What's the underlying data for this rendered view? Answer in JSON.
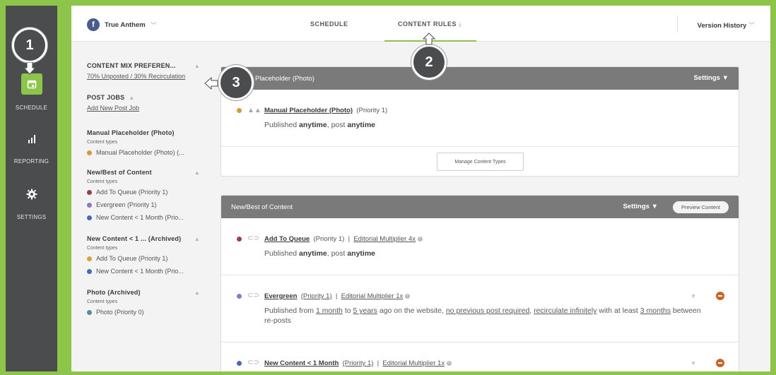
{
  "rail": {
    "items": [
      {
        "label": "SCHEDULE",
        "icon": "calendar-icon"
      },
      {
        "label": "REPORTING",
        "icon": "bar-chart-icon"
      },
      {
        "label": "SETTINGS",
        "icon": "gear-icon"
      }
    ]
  },
  "topbar": {
    "account_name": "True Anthem",
    "account_icon_letter": "f",
    "tabs": [
      {
        "label": "SCHEDULE"
      },
      {
        "label": "CONTENT RULES"
      }
    ],
    "version_history": "Version History"
  },
  "sidebar": {
    "content_mix": {
      "heading": "CONTENT MIX PREFEREN...",
      "value": "70% Unposted / 30% Recirculation"
    },
    "post_jobs": {
      "heading": "POST JOBS",
      "link": "Add New Post Job"
    },
    "jobs": [
      {
        "heading": "Manual Placeholder (Photo)",
        "sub": "Content types",
        "types": [
          {
            "label": "Manual Placeholder (Photo) (...",
            "color": "#d49a3a"
          }
        ]
      },
      {
        "heading": "New/Best of Content",
        "sub": "Content types",
        "types": [
          {
            "label": "Add To Queue (Priority 1)",
            "color": "#9a3f4c"
          },
          {
            "label": "Evergreen (Priority 1)",
            "color": "#8a7ac0"
          },
          {
            "label": "New Content < 1 Month (Prio...",
            "color": "#4b68b8"
          }
        ]
      },
      {
        "heading": "New Content < 1 ... (Archived)",
        "sub": "Content types",
        "types": [
          {
            "label": "Add To Queue (Priority 1)",
            "color": "#d4a43a"
          },
          {
            "label": "New Content < 1 Month (Prio...",
            "color": "#4b68b8"
          }
        ]
      },
      {
        "heading": "Photo (Archived)",
        "sub": "Content types",
        "types": [
          {
            "label": "Photo (Priority 0)",
            "color": "#5a8aa0"
          }
        ]
      }
    ]
  },
  "card1": {
    "title": "Placeholder (Photo)",
    "settings": "Settings",
    "row": {
      "name": "Manual Placeholder (Photo)",
      "priority": "(Priority 1)",
      "desc_a": "Published ",
      "desc_b": "anytime",
      "desc_c": ", post ",
      "desc_d": "anytime",
      "dot_color": "#d49a3a"
    },
    "manage": "Manage Content Types"
  },
  "card2": {
    "title": "New/Best of Content",
    "settings": "Settings",
    "preview": "Preview Content",
    "rows": [
      {
        "name": "Add To Queue",
        "priority": "(Priority 1)",
        "sep": "|",
        "multiplier": "Editorial Multiplier 4x",
        "dot_color": "#9a3f4c"
      },
      {
        "name": "Evergreen",
        "priority": "(Priority 1)",
        "sep": "|",
        "multiplier": "Editorial Multiplier 1x",
        "dot_color": "#8a7ac0"
      },
      {
        "name": "New Content < 1 Month",
        "priority": "(Priority 1)",
        "sep": "|",
        "multiplier": "Editorial Multiplier 1x",
        "dot_color": "#4b68b8"
      }
    ],
    "row1_desc": {
      "a": "Published ",
      "b": "anytime",
      "c": ", post ",
      "d": "anytime"
    },
    "row2_desc": {
      "a": "Published from ",
      "b": "1 month",
      "c": " to ",
      "d": "5 years",
      "e": " ago on the website, ",
      "f": "no previous post required",
      "g": ", ",
      "h": "recirculate infinitely",
      "i": " with at least ",
      "j": "3 months",
      "k": " between re-posts"
    }
  },
  "callouts": [
    "1",
    "2",
    "3"
  ]
}
